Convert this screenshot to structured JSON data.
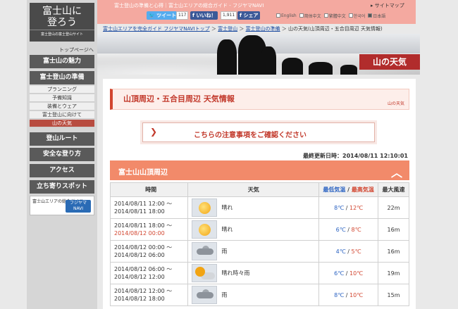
{
  "header": {
    "tagline": "富士登山の準備と心得｜富士山エリアの総合ガイド - フジヤマNAVI",
    "sitemap": "サイトマップ",
    "tweet": "ツイート",
    "tweet_count": "117",
    "like": "いいね！",
    "like_count": "1,911",
    "share": "シェア",
    "languages": [
      {
        "label": "English",
        "checked": false
      },
      {
        "label": "简体中文",
        "checked": false
      },
      {
        "label": "繁體中文",
        "checked": false
      },
      {
        "label": "한국어",
        "checked": false
      },
      {
        "label": "日本語",
        "checked": true
      }
    ]
  },
  "logo": {
    "title_line1": "富士山に",
    "title_line2": "登ろう",
    "subtitle": "富士登山の富士登山サイト"
  },
  "sidebar": {
    "top_link": "トップページへ",
    "items": [
      {
        "label": "富士山の魅力",
        "type": "big"
      },
      {
        "label": "富士登山の準備",
        "type": "big"
      },
      {
        "label": "プランニング",
        "type": "sub"
      },
      {
        "label": "予備知識",
        "type": "sub"
      },
      {
        "label": "装備とウェア",
        "type": "sub"
      },
      {
        "label": "富士登山に向けて",
        "type": "sub"
      },
      {
        "label": "山の天気",
        "type": "sub",
        "active": true
      },
      {
        "label": "登山ルート",
        "type": "big"
      },
      {
        "label": "安全な登り方",
        "type": "big"
      },
      {
        "label": "アクセス",
        "type": "big"
      },
      {
        "label": "立ち寄りスポット",
        "type": "big"
      }
    ],
    "navi_banner": {
      "text": "富士山エリアの総合ガイド",
      "brand": "フジヤマNAVI"
    }
  },
  "breadcrumb": {
    "items": [
      "富士山エリアを完全ガイド フジヤマNAVIトップ",
      "富士登山",
      "富士登山の準備"
    ],
    "current": "山の天気(山頂周辺・五合目周辺 天気情報)"
  },
  "hero": {
    "label": "山の天気"
  },
  "page": {
    "heading": "山頂周辺・五合目周辺 天気情報",
    "heading_tag": "山の天気",
    "notice": "こちらの注意事項をご確認ください",
    "updated": "最終更新日時：2014/08/11 12:10:01"
  },
  "area": {
    "title": "富士山山頂周辺",
    "columns": {
      "time": "時間",
      "weather": "天気",
      "temp_min": "最低気温",
      "temp_sep": " / ",
      "temp_max": "最高気温",
      "wind": "最大風速"
    },
    "rows": [
      {
        "start": "2014/08/11 12:00 〜",
        "end": "2014/08/11 18:00",
        "end_red": false,
        "icon": "sunny-icon",
        "weather": "晴れ",
        "min": "8℃",
        "max": "12℃",
        "wind": "22m"
      },
      {
        "start": "2014/08/11 18:00 〜",
        "end": "2014/08/12 00:00",
        "end_red": true,
        "icon": "sunny-icon",
        "weather": "晴れ",
        "min": "6℃",
        "max": "8℃",
        "wind": "16m"
      },
      {
        "start": "2014/08/12 00:00 〜",
        "end": "2014/08/12 06:00",
        "end_red": false,
        "icon": "rain-icon",
        "weather": "雨",
        "min": "4℃",
        "max": "5℃",
        "wind": "16m"
      },
      {
        "start": "2014/08/12 06:00 〜",
        "end": "2014/08/12 12:00",
        "end_red": false,
        "icon": "sunny-cloudy-icon",
        "weather": "晴れ時々雨",
        "min": "6℃",
        "max": "10℃",
        "wind": "19m"
      },
      {
        "start": "2014/08/12 12:00 〜",
        "end": "2014/08/12 18:00",
        "end_red": false,
        "icon": "rain-icon",
        "weather": "雨",
        "min": "8℃",
        "max": "10℃",
        "wind": "15m"
      }
    ]
  }
}
